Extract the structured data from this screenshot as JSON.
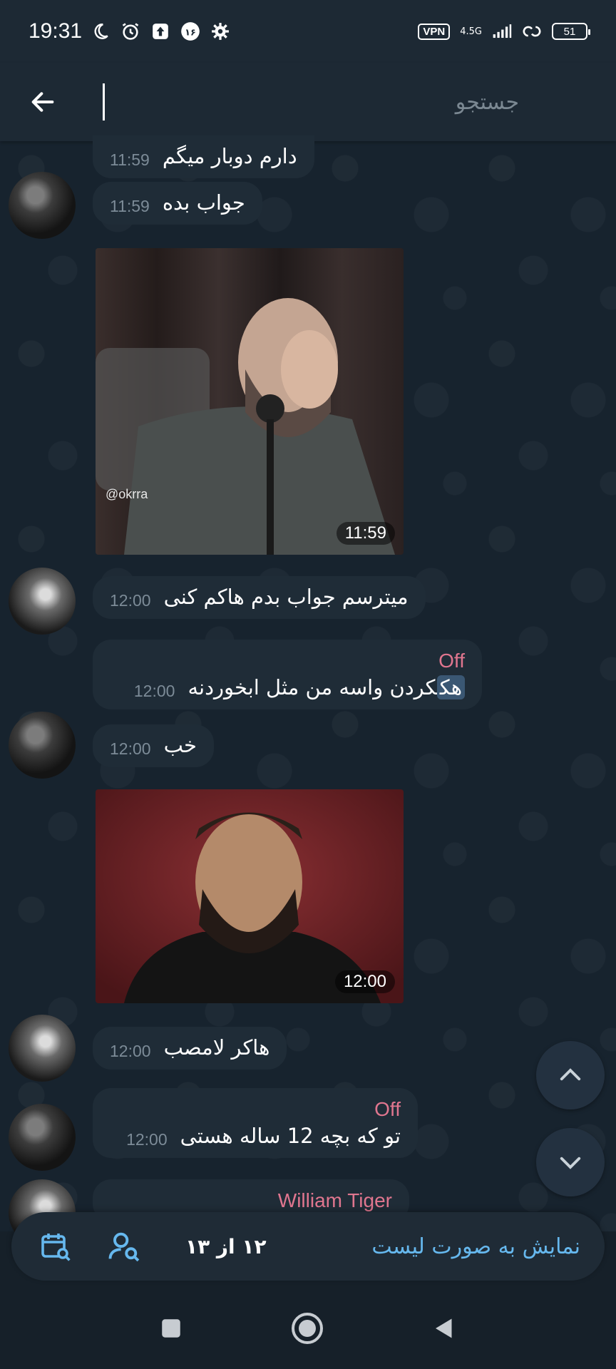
{
  "status_bar": {
    "time": "19:31",
    "vpn_label": "VPN",
    "network_type": "4.5G",
    "battery_level": "51"
  },
  "search": {
    "placeholder": "جستجو"
  },
  "messages": [
    {
      "text": "دارم دوبار میگم",
      "time": "11:59"
    },
    {
      "text": "جواب بده",
      "time": "11:59"
    },
    {
      "media_caption": "@okrra",
      "time": "11:59"
    },
    {
      "text": "میترسم جواب بدم هاکم کنی",
      "time": "12:00"
    },
    {
      "sender": "Off",
      "text_highlight": "هک",
      "text_rest": "کردن واسه من مثل ابخوردنه",
      "time": "12:00"
    },
    {
      "text": "خب",
      "time": "12:00"
    },
    {
      "time": "12:00"
    },
    {
      "text": "هاکر لامصب",
      "time": "12:00"
    },
    {
      "sender": "Off",
      "text": "تو که بچه 12 ساله هستی",
      "time": "12:00"
    },
    {
      "sender": "William Tiger"
    }
  ],
  "bottom_bar": {
    "counter": "۱۲ از ۱۳",
    "list_toggle": "نمایش به صورت لیست"
  },
  "colors": {
    "accent_blue": "#66b8ee",
    "sender_pink": "#e0768f",
    "bubble_bg": "#1f2c37"
  }
}
